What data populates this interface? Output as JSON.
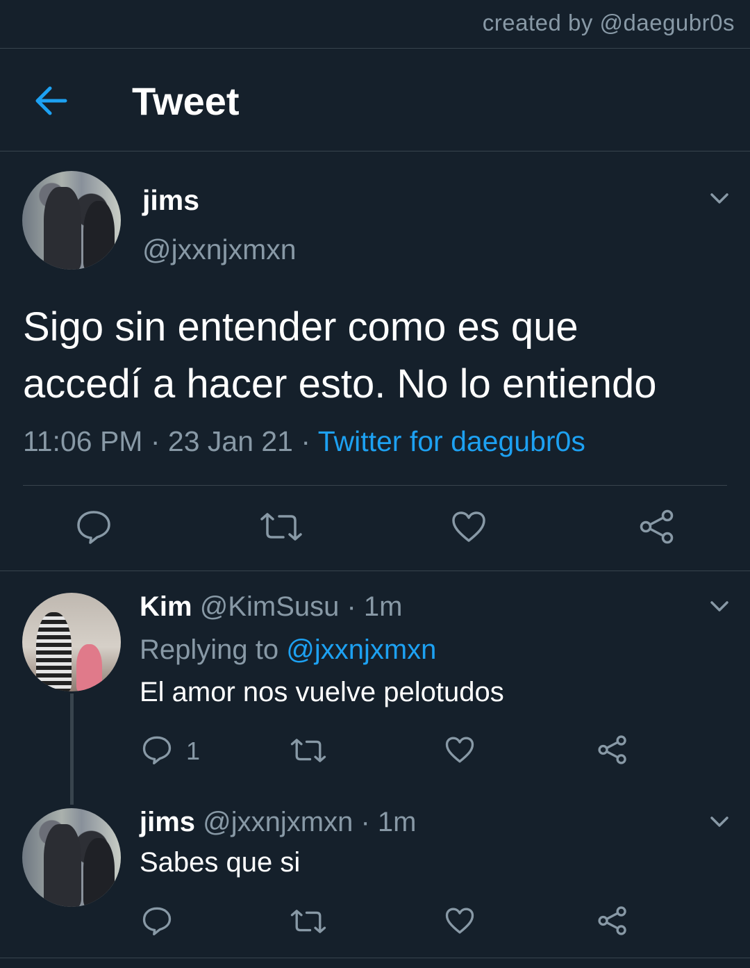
{
  "credit": "created by @daegubr0s",
  "header": {
    "title": "Tweet"
  },
  "tweet": {
    "name": "jims",
    "handle": "@jxxnjxmxn",
    "text_line1": "Sigo sin entender como es que",
    "text_line2": "accedí a hacer esto. No lo entiendo",
    "time": "11:06 PM",
    "sep1": " · ",
    "date": "23 Jan 21",
    "sep2": " · ",
    "source": "Twitter for daegubr0s"
  },
  "replies": [
    {
      "name": "Kim",
      "handle": "@KimSusu",
      "sep": " · ",
      "time": "1m",
      "replying_prefix": "Replying to ",
      "replying_to": "@jxxnjxmxn",
      "text": "El amor nos vuelve pelotudos",
      "reply_count": "1"
    },
    {
      "name": "jims",
      "handle": "@jxxnjxmxn",
      "sep": " · ",
      "time": "1m",
      "text": "Sabes que si"
    }
  ],
  "icons": {
    "back": "arrow-left-icon",
    "more": "chevron-down-icon",
    "reply": "speech-bubble-icon",
    "retweet": "retweet-icon",
    "like": "heart-icon",
    "share": "share-icon"
  },
  "colors": {
    "background": "#15202b",
    "divider": "#38444d",
    "muted": "#8899a6",
    "accent": "#1da1f2",
    "text": "#ffffff"
  }
}
